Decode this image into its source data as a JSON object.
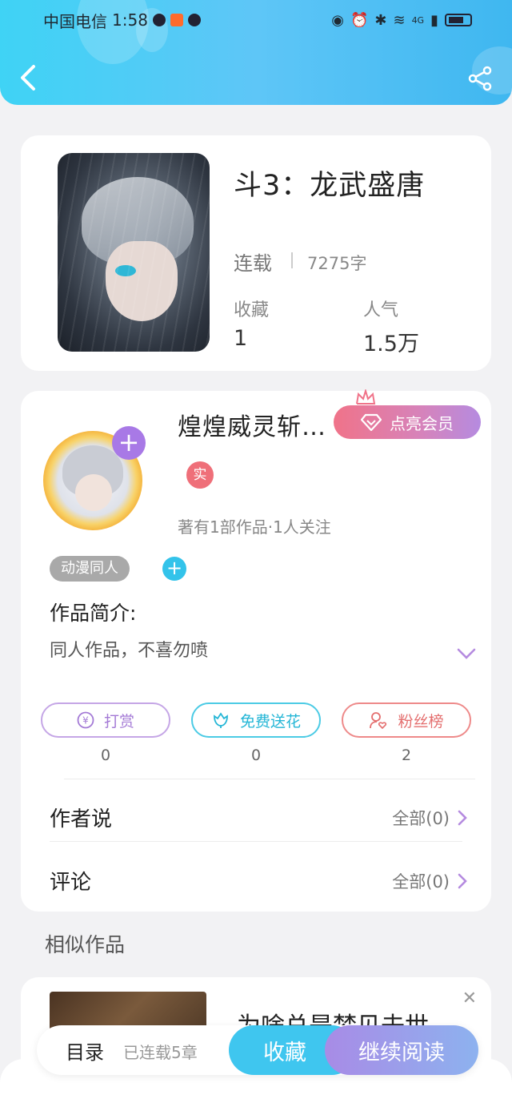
{
  "status_bar": {
    "carrier": "中国电信",
    "time": "1:58",
    "network": "4G"
  },
  "book": {
    "title": "斗3：龙武盛唐",
    "status": "连载",
    "words": "7275字",
    "stats": [
      {
        "label": "收藏",
        "value": "1"
      },
      {
        "label": "人气",
        "value": "1.5万"
      }
    ]
  },
  "author": {
    "name": "煌煌威灵斩…",
    "vip_label": "点亮会员",
    "real_badge": "实",
    "meta": "著有1部作品·1人关注",
    "tag": "动漫同人",
    "intro_label": "作品简介:",
    "intro_text": "同人作品，不喜勿喷"
  },
  "actions": [
    {
      "label": "打赏",
      "count": "0",
      "icon": "yen-icon"
    },
    {
      "label": "免费送花",
      "count": "0",
      "icon": "flower-icon"
    },
    {
      "label": "粉丝榜",
      "count": "2",
      "icon": "fans-icon"
    }
  ],
  "rows": [
    {
      "label": "作者说",
      "right": "全部(0)"
    },
    {
      "label": "评论",
      "right": "全部(0)"
    }
  ],
  "similar": {
    "title": "相似作品",
    "book_title": "为啥总是梦见去世"
  },
  "bottom": {
    "toc": "目录",
    "serial": "已连载5章",
    "favorite": "收藏",
    "continue": "继续阅读"
  },
  "colors": {
    "header": "#46c6f4",
    "accent_purple": "#a879e6",
    "accent_blue": "#3fc6ef",
    "vip_pink": "#f07389"
  }
}
